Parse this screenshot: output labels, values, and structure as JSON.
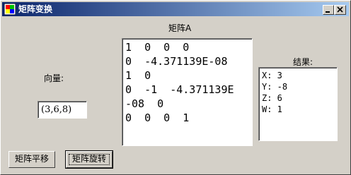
{
  "window": {
    "title": "矩阵变换"
  },
  "labels": {
    "matrix": "矩阵A",
    "vector": "向量:",
    "result": "结果:"
  },
  "vector_input": {
    "value": "(3,6,8)"
  },
  "matrix_text": "1  0  0  0\n0  -4.371139E-08\n1  0\n0  -1  -4.371139E\n-08  0\n0  0  0  1",
  "result_text": "X: 3\nY: -8\nZ: 6\nW: 1",
  "buttons": {
    "translate": "矩阵平移",
    "rotate": "矩阵旋转"
  },
  "icons": {
    "app": "app-icon",
    "minimize": "minimize-icon",
    "maximize": "maximize-icon",
    "close": "close-icon"
  },
  "colors": {
    "titlebar_start": "#0a246a",
    "titlebar_end": "#a6caf0",
    "face": "#d4d0c8"
  }
}
